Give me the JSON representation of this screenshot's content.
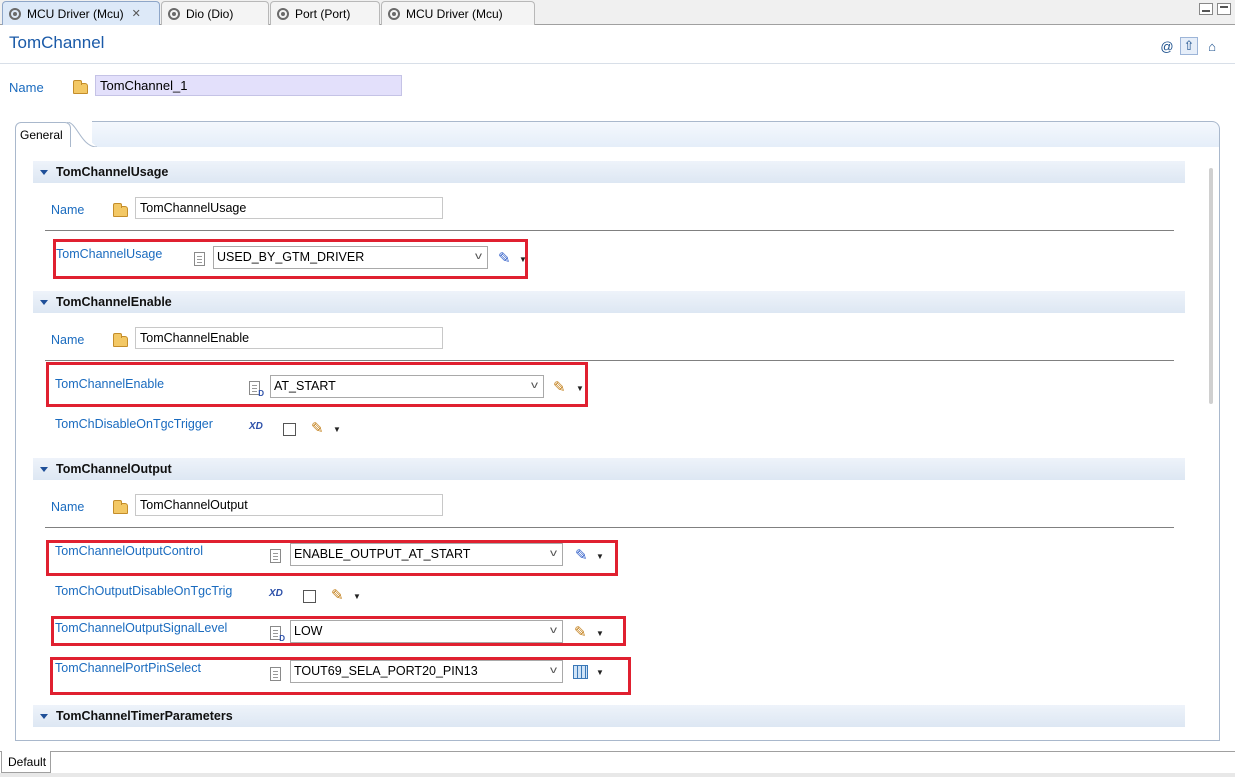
{
  "tabs": [
    {
      "label": "MCU Driver (Mcu)",
      "active": true,
      "closable": true
    },
    {
      "label": "Dio (Dio)",
      "active": false
    },
    {
      "label": "Port (Port)",
      "active": false
    },
    {
      "label": "MCU Driver (Mcu)",
      "active": false
    }
  ],
  "header": {
    "title": "TomChannel",
    "name_label": "Name",
    "name_value": "TomChannel_1"
  },
  "general_tab": {
    "label": "General"
  },
  "sections": {
    "usage": {
      "title": "TomChannelUsage",
      "name_label": "Name",
      "name_value": "TomChannelUsage",
      "param_label": "TomChannelUsage",
      "param_value": "USED_BY_GTM_DRIVER"
    },
    "enable": {
      "title": "TomChannelEnable",
      "name_label": "Name",
      "name_value": "TomChannelEnable",
      "param_label": "TomChannelEnable",
      "param_value": "AT_START",
      "disable_label": "TomChDisableOnTgcTrigger"
    },
    "output": {
      "title": "TomChannelOutput",
      "name_label": "Name",
      "name_value": "TomChannelOutput",
      "control_label": "TomChannelOutputControl",
      "control_value": "ENABLE_OUTPUT_AT_START",
      "disable_label": "TomChOutputDisableOnTgcTrig",
      "signal_label": "TomChannelOutputSignalLevel",
      "signal_value": "LOW",
      "pin_label": "TomChannelPortPinSelect",
      "pin_value": "TOUT69_SELA_PORT20_PIN13"
    },
    "timer": {
      "title": "TomChannelTimerParameters"
    }
  },
  "bottom_tab": {
    "label": "Default"
  },
  "icons": {
    "tab": "plugin-icon",
    "name": "folder-icon",
    "param": "document-icon",
    "calculated": "calculator-icon",
    "edit": "pencil-icon",
    "pin": "grid-icon"
  },
  "colors": {
    "link": "#1a6bbf",
    "highlight": "#e02030",
    "title": "#1a5aa8"
  }
}
